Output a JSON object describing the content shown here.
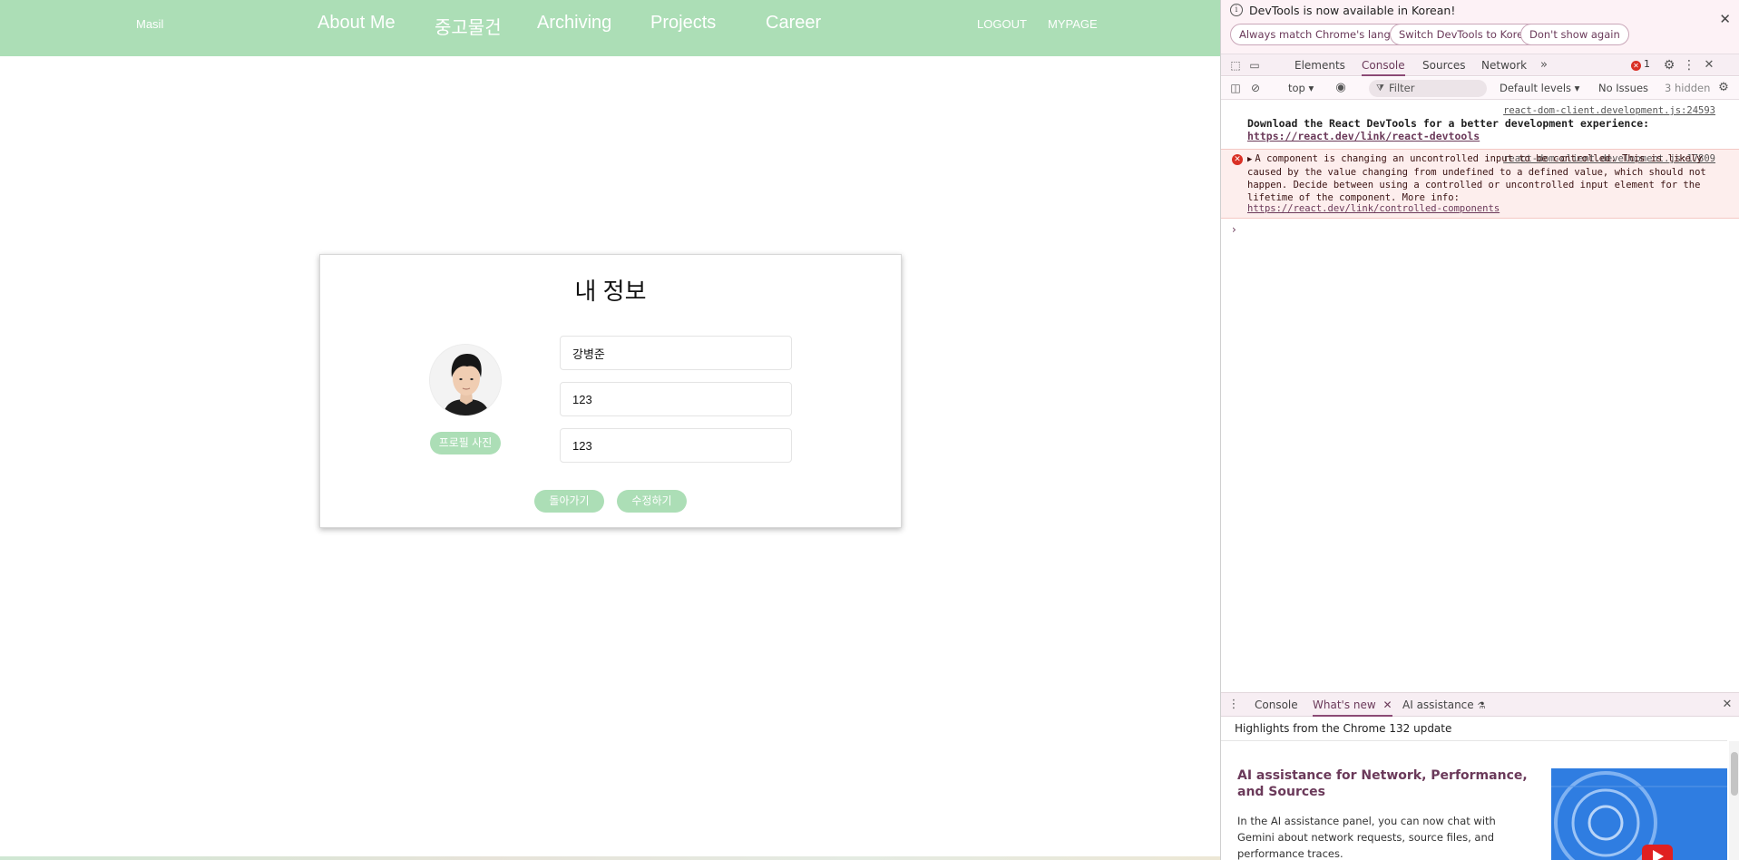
{
  "navbar": {
    "brand": "Masil",
    "links": [
      "About Me",
      "중고물건",
      "Archiving",
      "Projects",
      "Career"
    ],
    "logout": "LOGOUT",
    "mypage": "MYPAGE",
    "color": "#acdeb6"
  },
  "profile_card": {
    "title": "내 정보",
    "photo_button": "프로필 사진",
    "fields": [
      "강병준",
      "123",
      "123"
    ],
    "back_button": "돌아가기",
    "edit_button": "수정하기"
  },
  "devtools": {
    "infobar": {
      "message": "DevTools is now available in Korean!",
      "buttons": [
        "Always match Chrome's language",
        "Switch DevTools to Korean",
        "Don't show again"
      ]
    },
    "tabs": [
      "Elements",
      "Console",
      "Sources",
      "Network"
    ],
    "active_tab": "Console",
    "error_count": "1",
    "toolbar": {
      "context": "top",
      "filter_placeholder": "Filter",
      "levels": "Default levels",
      "issues": "No Issues",
      "hidden": "3 hidden"
    },
    "messages": {
      "info_source": "react-dom-client.development.js:24593",
      "info_text": "Download the React DevTools for a better development experience:",
      "info_link": "https://react.dev/link/react-devtools",
      "error_source": "react-dom-client.development.js:17809",
      "error_text": "A component is changing an uncontrolled input to be controlled. This is likely caused by the value changing from undefined to a defined value, which should not happen. Decide between using a controlled or uncontrolled input element for the lifetime of the component. More info:",
      "error_link": "https://react.dev/link/controlled-components"
    },
    "drawer": {
      "tabs": [
        "Console",
        "What's new",
        "AI assistance"
      ],
      "active_tab": "What's new",
      "highlights": "Highlights from the Chrome 132 update",
      "feature_title": "AI assistance for Network, Performance, and Sources",
      "feature_body": "In the AI assistance panel, you can now chat with Gemini about network requests, source files, and performance traces."
    }
  }
}
